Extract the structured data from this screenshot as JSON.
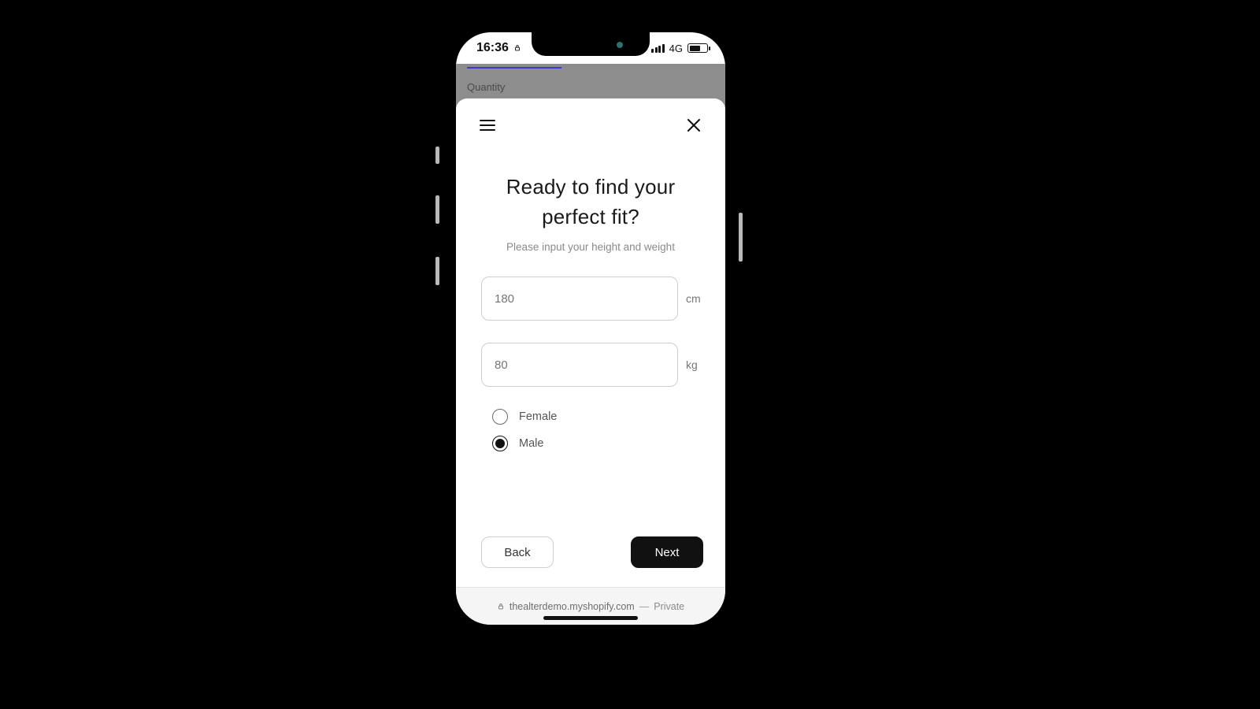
{
  "statusbar": {
    "time": "16:36",
    "network_label": "4G"
  },
  "background_page": {
    "quantity_label": "Quantity"
  },
  "sheet": {
    "title_line1": "Ready to find your",
    "title_line2": "perfect fit?",
    "subtitle": "Please input your height and weight",
    "height": {
      "placeholder": "180",
      "value": "",
      "unit": "cm"
    },
    "weight": {
      "placeholder": "80",
      "value": "",
      "unit": "kg"
    },
    "gender": {
      "options": [
        {
          "label": "Female",
          "selected": false
        },
        {
          "label": "Male",
          "selected": true
        }
      ]
    },
    "back_label": "Back",
    "next_label": "Next"
  },
  "browser": {
    "domain": "thealterdemo.myshopify.com",
    "separator": "—",
    "mode": "Private"
  }
}
